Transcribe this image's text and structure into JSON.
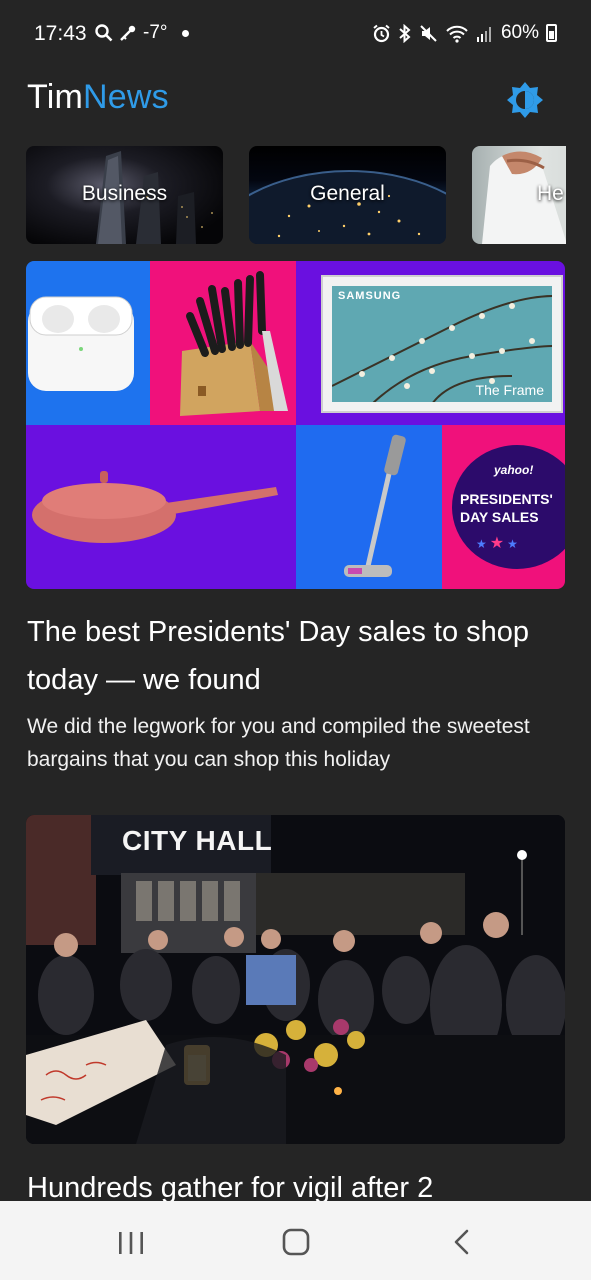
{
  "status_bar": {
    "time": "17:43",
    "temperature": "-7°",
    "battery": "60%",
    "icons": [
      "search-icon",
      "key-icon",
      "dot-icon",
      "alarm-icon",
      "bluetooth-icon",
      "mute-icon",
      "wifi-icon",
      "signal-icon",
      "battery-icon"
    ]
  },
  "header": {
    "title_part1": "Tim",
    "title_part2": "News",
    "accent_color": "#2f9be8",
    "theme_icon": "brightness-icon"
  },
  "categories": [
    {
      "label": "Business"
    },
    {
      "label": "General"
    },
    {
      "label": "He"
    }
  ],
  "articles": [
    {
      "title": "The best Presidents' Day sales to shop today — we found",
      "description": "We did the legwork for you and compiled the sweetest bargains that you can shop this holiday",
      "image": {
        "samsung": "SAMSUNG",
        "frame": "The Frame",
        "yahoo": "yahoo!",
        "presidents": "PRESIDENTS'",
        "day_sales": "DAY SALES"
      }
    },
    {
      "title": "Hundreds gather for vigil after 2",
      "image": {
        "sign": "CITY HALL"
      }
    }
  ],
  "nav": {
    "recents_icon": "recents-icon",
    "home_icon": "home-icon",
    "back_icon": "back-icon"
  }
}
